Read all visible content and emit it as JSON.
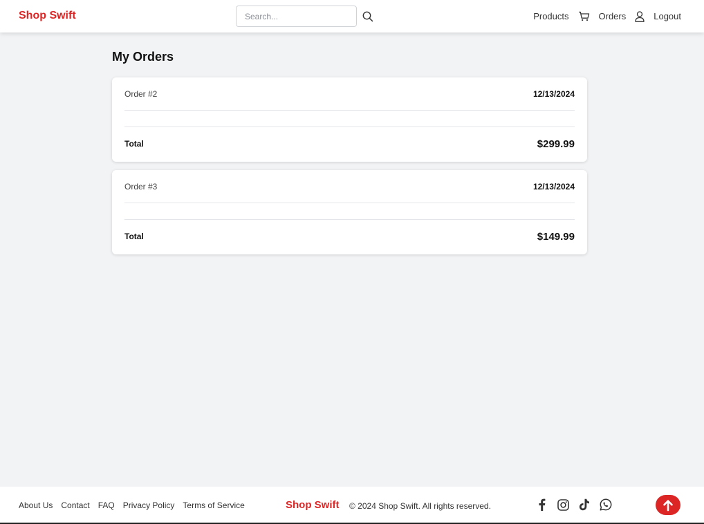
{
  "header": {
    "brand": "Shop Swift",
    "search_placeholder": "Search...",
    "nav": {
      "products": "Products",
      "orders": "Orders",
      "logout": "Logout"
    }
  },
  "page": {
    "title": "My Orders"
  },
  "orders": [
    {
      "id_label": "Order #2",
      "date": "12/13/2024",
      "total_label": "Total",
      "total": "$299.99"
    },
    {
      "id_label": "Order #3",
      "date": "12/13/2024",
      "total_label": "Total",
      "total": "$149.99"
    }
  ],
  "footer": {
    "links": {
      "about": "About Us",
      "contact": "Contact",
      "faq": "FAQ",
      "privacy": "Privacy Policy",
      "terms": "Terms of Service"
    },
    "brand": "Shop Swift",
    "copyright": "© 2024 Shop Swift. All rights reserved.",
    "socials": [
      "facebook-icon",
      "instagram-icon",
      "tiktok-icon",
      "whatsapp-icon"
    ]
  },
  "colors": {
    "brand": "#dc2626",
    "background": "#f2f3f5"
  }
}
